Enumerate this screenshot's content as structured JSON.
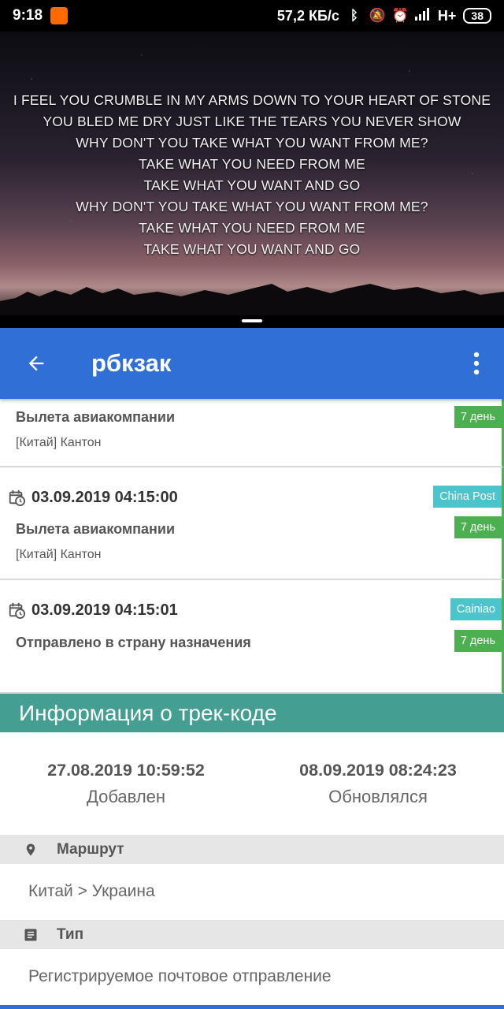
{
  "status_bar": {
    "time": "9:18",
    "net_speed": "57,2 КБ/с",
    "network": "H+",
    "battery": "38"
  },
  "video": {
    "lyrics": [
      "I FEEL YOU CRUMBLE IN MY ARMS DOWN TO YOUR HEART OF STONE",
      "YOU BLED ME DRY JUST LIKE THE TEARS YOU NEVER SHOW",
      "WHY DON'T YOU TAKE WHAT YOU WANT FROM ME?",
      "TAKE WHAT YOU NEED FROM ME",
      "TAKE WHAT YOU WANT AND GO",
      "WHY DON'T YOU TAKE WHAT YOU WANT FROM ME?",
      "TAKE WHAT YOU NEED FROM ME",
      "TAKE WHAT YOU WANT AND GO"
    ]
  },
  "app_bar": {
    "title": "рбкзак",
    "color": "#2f6fd6"
  },
  "events": [
    {
      "date": "",
      "status": "Вылета авиакомпании",
      "place": "[Китай] Кантон",
      "carrier": "",
      "days": "7 день"
    },
    {
      "date": "03.09.2019 04:15:00",
      "status": "Вылета авиакомпании",
      "place": "[Китай] Кантон",
      "carrier": "China Post",
      "days": "7 день"
    },
    {
      "date": "03.09.2019 04:15:01",
      "status": "Отправлено в страну назначения",
      "place": "",
      "carrier": "Cainiao",
      "days": "7 день"
    }
  ],
  "info": {
    "header": "Информация о трек-коде",
    "added_value": "27.08.2019 10:59:52",
    "added_label": "Добавлен",
    "updated_value": "08.09.2019 08:24:23",
    "updated_label": "Обновлялся",
    "route_label": "Маршрут",
    "route_value": "Китай > Украина",
    "type_label": "Тип",
    "type_value": "Регистрируемое почтовое отправление"
  },
  "colors": {
    "accent": "#2f6fd6",
    "days_tag": "#4caf50",
    "carrier_tag": "#4bc4cc",
    "info_header": "#449e92"
  },
  "icons": [
    "back-arrow-icon",
    "more-vert-icon",
    "calendar-clock-icon",
    "location-pin-icon",
    "document-icon"
  ]
}
